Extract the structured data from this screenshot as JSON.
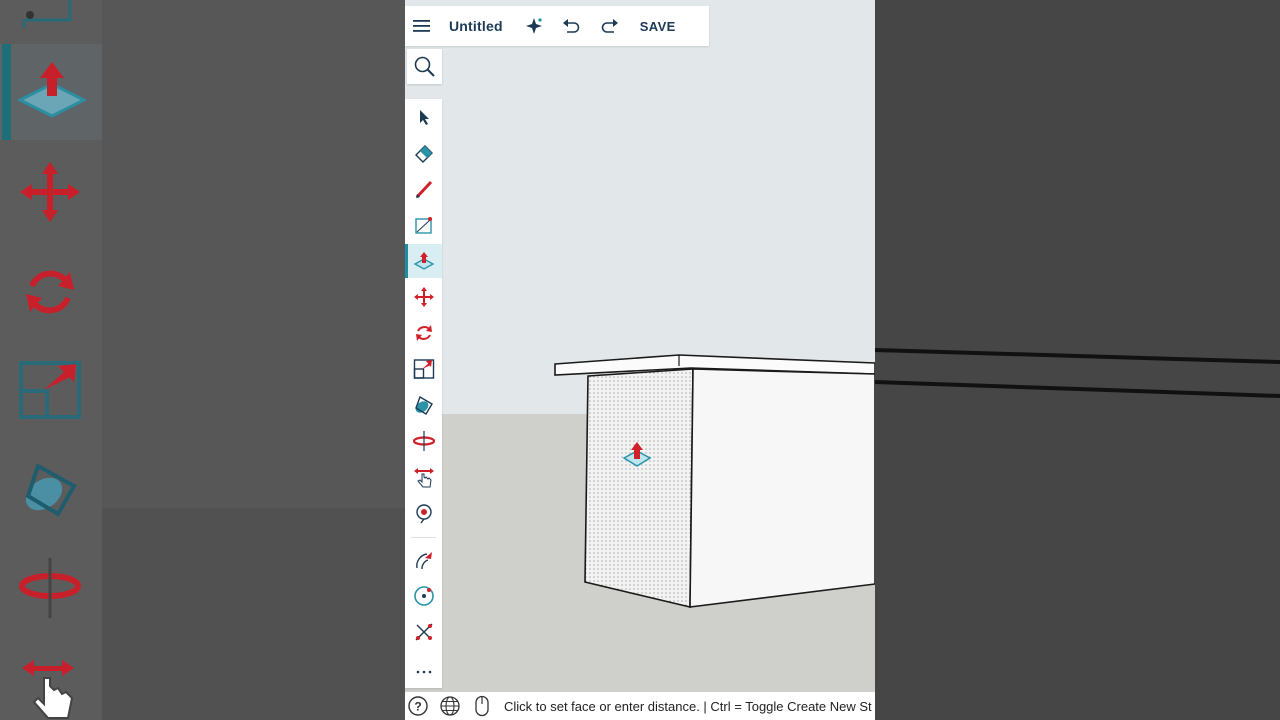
{
  "app": {
    "title": "Untitled",
    "save_label": "SAVE"
  },
  "icons": {
    "menu": "hamburger-menu-icon",
    "ai": "sparkle-icon",
    "undo": "undo-icon",
    "redo": "redo-icon",
    "search": "search-icon"
  },
  "tools": [
    {
      "name": "select-tool",
      "icon": "arrow-cursor-icon"
    },
    {
      "name": "eraser-tool",
      "icon": "eraser-icon"
    },
    {
      "name": "pencil-tool",
      "icon": "pencil-icon"
    },
    {
      "name": "shape-tool",
      "icon": "rectangle-draw-icon"
    },
    {
      "name": "push-pull-tool",
      "icon": "push-pull-icon",
      "active": true
    },
    {
      "name": "move-tool",
      "icon": "move-arrows-icon"
    },
    {
      "name": "rotate-tool",
      "icon": "rotate-icon"
    },
    {
      "name": "scale-tool",
      "icon": "scale-icon"
    },
    {
      "name": "paint-tool",
      "icon": "paint-bucket-icon"
    },
    {
      "name": "orbit-tool",
      "icon": "orbit-icon"
    },
    {
      "name": "pan-tool",
      "icon": "pan-hand-icon"
    },
    {
      "name": "position-camera-tool",
      "icon": "position-camera-icon"
    },
    {
      "name": "walk-tool",
      "icon": "walk-icon"
    },
    {
      "name": "look-around-tool",
      "icon": "look-around-icon"
    },
    {
      "name": "tape-measure-tool",
      "icon": "tape-measure-icon"
    },
    {
      "name": "more-tools",
      "icon": "more-dots-icon"
    }
  ],
  "status": {
    "help_icon": "help-icon",
    "globe_icon": "globe-icon",
    "mouse_icon": "mouse-icon",
    "text": "Click to set face or enter distance. | Ctrl = Toggle Create New St"
  },
  "colors": {
    "accent": "#1f8ea1",
    "title": "#1d3a55",
    "red": "#d0202a"
  }
}
